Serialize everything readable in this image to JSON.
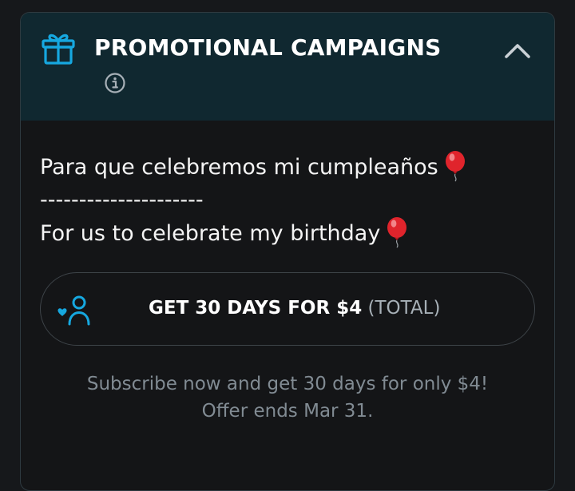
{
  "header": {
    "title": "PROMOTIONAL CAMPAIGNS",
    "icons": {
      "gift": "gift-icon",
      "info": "info-icon",
      "collapse": "chevron-up-icon"
    }
  },
  "message": {
    "line1": "Para que celebremos mi cumpleaños",
    "divider": "---------------------",
    "line2": "For us to celebrate my birthday",
    "emoji": "balloon-icon"
  },
  "offer": {
    "label": "GET 30 DAYS FOR $4",
    "suffix": "(TOTAL)",
    "icon": "fan-subscribe-icon"
  },
  "footer": {
    "line1": "Subscribe now and get 30 days for only $4!",
    "line2": "Offer ends Mar 31."
  },
  "colors": {
    "accent": "#16a8e0",
    "header_bg": "#102830",
    "card_bg": "#141517",
    "page_bg": "#16181b",
    "balloon": "#e0242c"
  }
}
